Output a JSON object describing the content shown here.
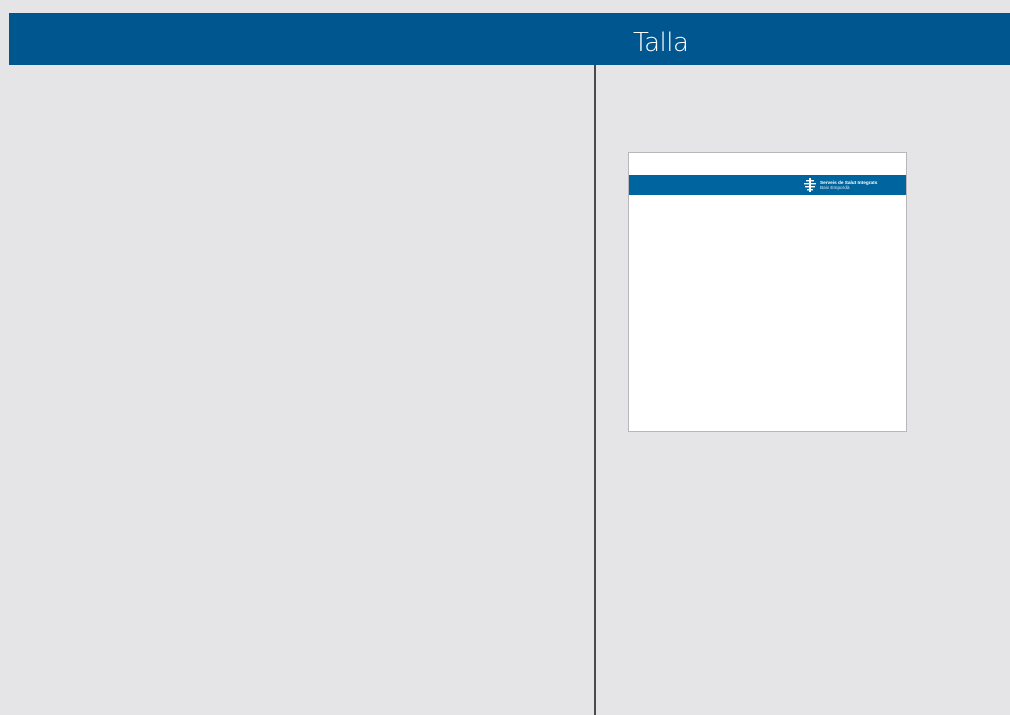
{
  "header": {
    "title": "Talla"
  },
  "preview": {
    "logo": {
      "line1": "Serveis de Salut Integrats",
      "line2": "Baix Empordà"
    }
  },
  "colors": {
    "header_bar": "#00568f",
    "card_band": "#00659e",
    "background": "#e5e5e7",
    "divider": "#4a4a4c"
  },
  "icons": {
    "logo_mark": "cross-logo-icon"
  }
}
